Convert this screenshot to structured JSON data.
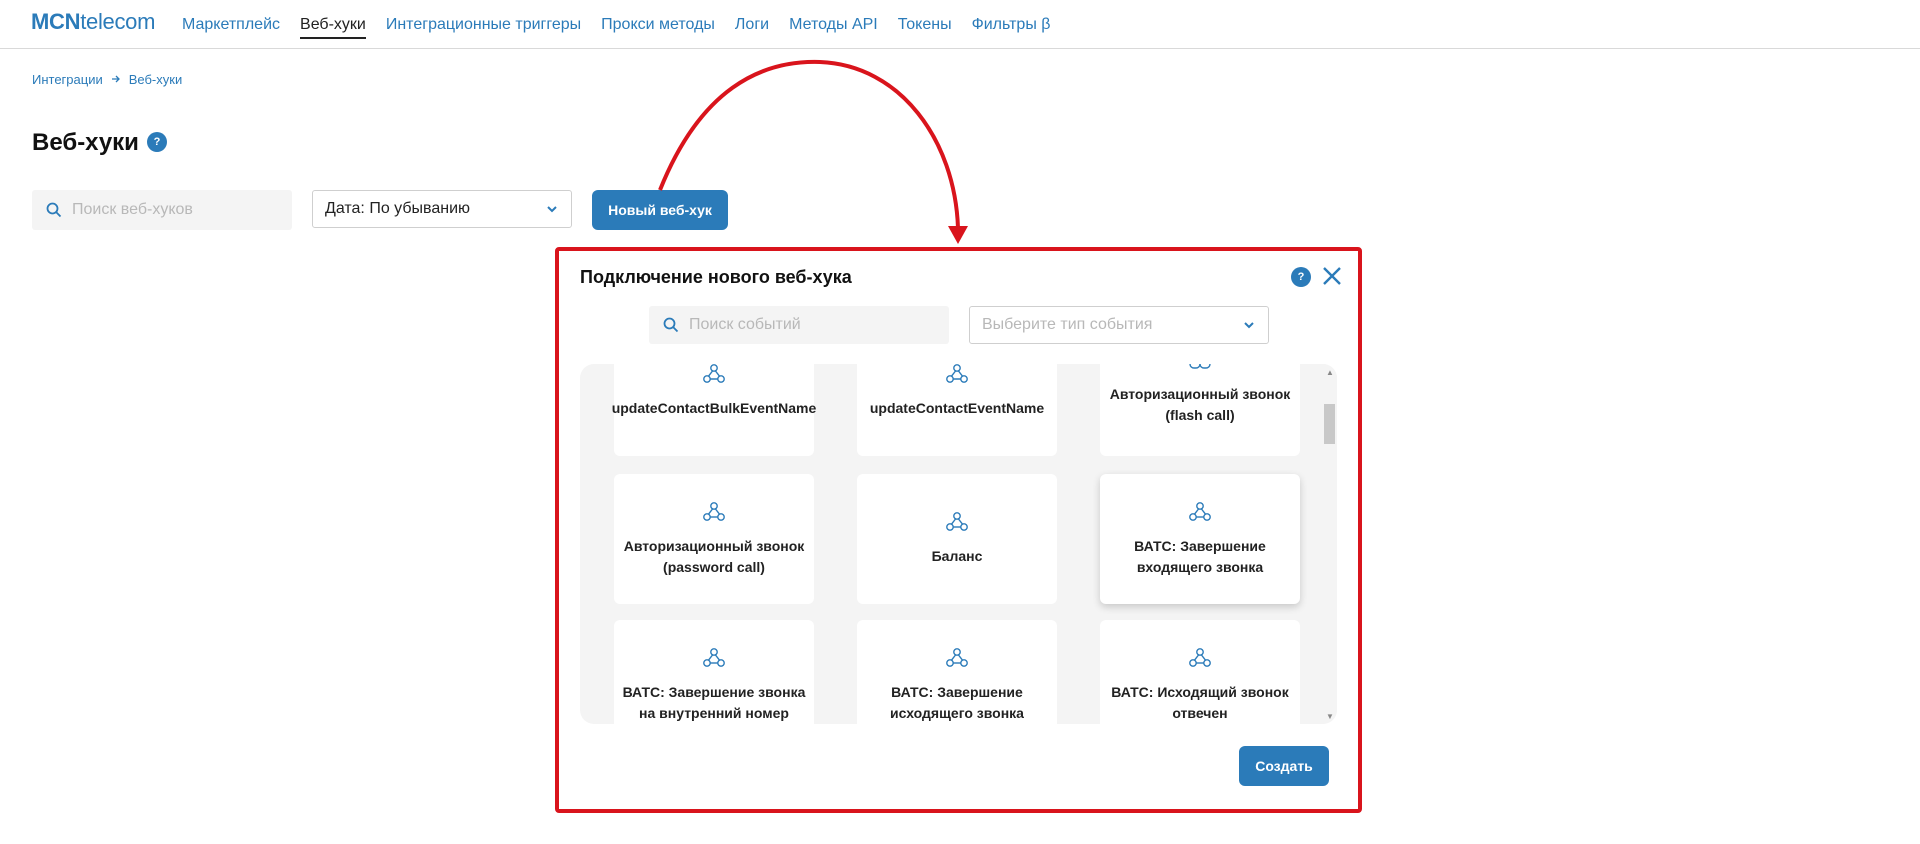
{
  "header": {
    "logo_bold": "MCN",
    "logo_rest": "telecom",
    "nav": [
      {
        "label": "Маркетплейс",
        "active": false
      },
      {
        "label": "Веб-хуки",
        "active": true
      },
      {
        "label": "Интеграционные триггеры",
        "active": false
      },
      {
        "label": "Прокси методы",
        "active": false
      },
      {
        "label": "Логи",
        "active": false
      },
      {
        "label": "Методы API",
        "active": false
      },
      {
        "label": "Токены",
        "active": false
      },
      {
        "label": "Фильтры β",
        "active": false
      }
    ]
  },
  "breadcrumb": {
    "items": [
      "Интеграции",
      "Веб-хуки"
    ]
  },
  "page": {
    "title": "Веб-хуки",
    "help": "?"
  },
  "toolbar": {
    "search_placeholder": "Поиск веб-хуков",
    "sort_value": "Дата: По убыванию",
    "new_button": "Новый веб-хук"
  },
  "modal": {
    "title": "Подключение нового веб-хука",
    "help": "?",
    "search_placeholder": "Поиск событий",
    "event_type_placeholder": "Выберите тип события",
    "events": [
      "updateContactBulkEventName",
      "updateContactEventName",
      "Авторизационный звонок (flash call)",
      "Авторизационный звонок (password call)",
      "Баланс",
      "ВАТС: Завершение входящего звонка",
      "ВАТС: Завершение звонка на внутренний номер",
      "ВАТС: Завершение исходящего звонка",
      "ВАТС: Исходящий звонок отвечен"
    ],
    "create_button": "Создать"
  },
  "colors": {
    "accent": "#2b7bb9",
    "annotation": "#d9141c"
  }
}
